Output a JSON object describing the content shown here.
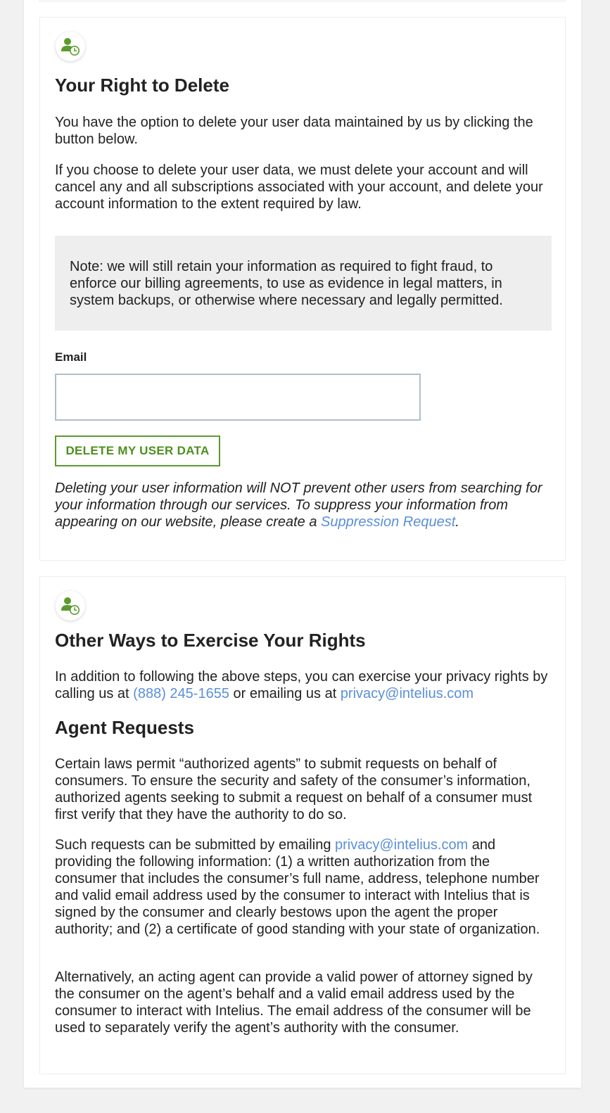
{
  "delete_section": {
    "icon": "user-clock-icon",
    "title": "Your Right to Delete",
    "para1": "You have the option to delete your user data maintained by us by clicking the button below.",
    "para2": "If you choose to delete your user data, we must delete your account and will cancel any and all subscriptions associated with your account, and delete your account information to the extent required by law.",
    "note": "Note: we will still retain your information as required to fight fraud, to enforce our billing agreements, to use as evidence in legal matters, in system backups, or otherwise where necessary and legally permitted.",
    "email_label": "Email",
    "email_value": "",
    "email_placeholder": "",
    "button_label": "DELETE MY USER DATA",
    "disclaimer_text": "Deleting your user information will NOT prevent other users from searching for your information through our services. To suppress your information from appearing on our website, please create a ",
    "disclaimer_link": "Suppression Request",
    "disclaimer_end": "."
  },
  "other_section": {
    "icon": "user-clock-icon",
    "title": "Other Ways to Exercise Your Rights",
    "intro_text": "In addition to following the above steps, you can exercise your privacy rights by calling us at ",
    "phone": "(888) 245-1655",
    "intro_mid": " or emailing us at ",
    "email": "privacy@intelius.com",
    "agent_title": "Agent Requests",
    "agent_para1": "Certain laws permit “authorized agents” to submit requests on behalf of consumers. To ensure the security and safety of the consumer’s information, authorized agents seeking to submit a request on behalf of a consumer must first verify that they have the authority to do so.",
    "agent_para2_start": "Such requests can be submitted by emailing ",
    "agent_para2_email": "privacy@intelius.com",
    "agent_para2_rest": " and providing the following information: (1) a written authorization from the consumer that includes the consumer’s full name, address, telephone number and valid email address used by the consumer to interact with Intelius that is signed by the consumer and clearly bestows upon the agent the proper authority; and (2) a certificate of good standing with your state of organization.",
    "agent_para3": "Alternatively, an acting agent can provide a valid power of attorney signed by the consumer on the agent’s behalf and a valid email address used by the consumer to interact with Intelius. The email address of the consumer will be used to separately verify the agent’s authority with the consumer."
  },
  "colors": {
    "accent_green": "#5c9a2e",
    "link_blue": "#5b8fd9",
    "note_bg": "#eeeeee"
  }
}
